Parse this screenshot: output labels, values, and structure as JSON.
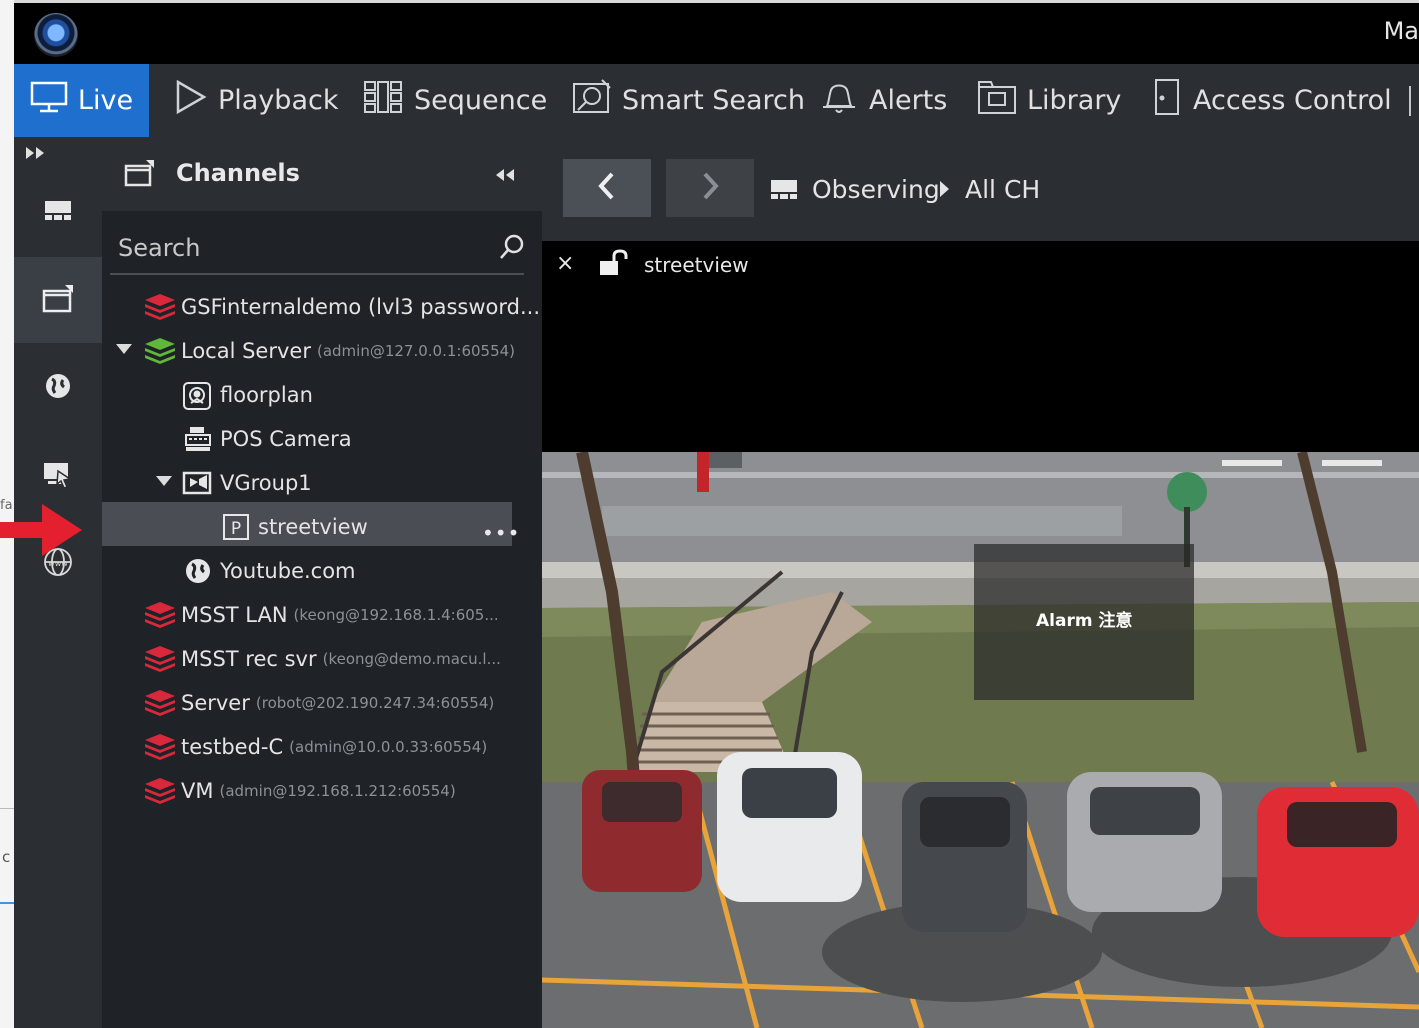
{
  "window": {
    "title_partial": "Ma"
  },
  "desktop": {
    "left_text_1": "fa",
    "left_text_2": "c"
  },
  "nav": {
    "items": [
      {
        "label": "Live",
        "icon": "monitor-icon",
        "active": true
      },
      {
        "label": "Playback",
        "icon": "play-icon"
      },
      {
        "label": "Sequence",
        "icon": "sequence-icon"
      },
      {
        "label": "Smart Search",
        "icon": "smart-search-icon"
      },
      {
        "label": "Alerts",
        "icon": "bell-icon"
      },
      {
        "label": "Library",
        "icon": "library-icon"
      },
      {
        "label": "Access Control",
        "icon": "door-icon"
      }
    ]
  },
  "rail": {
    "buttons": [
      "layout-icon",
      "channels-icon",
      "globe-icon",
      "remote-display-icon",
      "www-icon"
    ]
  },
  "panel": {
    "title": "Channels",
    "search_placeholder": "Search",
    "tree": [
      {
        "label": "GSFinternaldemo (lvl3 password...",
        "sub": "",
        "type": "server-red"
      },
      {
        "label": "Local Server",
        "sub": "(admin@127.0.0.1:60554)",
        "type": "server-green",
        "expanded": true
      },
      {
        "label": "floorplan",
        "sub": "",
        "type": "floorplan"
      },
      {
        "label": "POS Camera",
        "sub": "",
        "type": "pos"
      },
      {
        "label": "VGroup1",
        "sub": "",
        "type": "group",
        "expanded": true
      },
      {
        "label": "streetview",
        "sub": "",
        "type": "p-camera",
        "selected": true
      },
      {
        "label": "Youtube.com",
        "sub": "",
        "type": "globe"
      },
      {
        "label": "MSST LAN",
        "sub": "(keong@192.168.1.4:605...",
        "type": "server-red"
      },
      {
        "label": "MSST rec svr",
        "sub": "(keong@demo.macu.l...",
        "type": "server-red"
      },
      {
        "label": "Server",
        "sub": "(robot@202.190.247.34:60554)",
        "type": "server-red"
      },
      {
        "label": "testbed-C",
        "sub": "(admin@10.0.0.33:60554)",
        "type": "server-red"
      },
      {
        "label": "VM",
        "sub": "(admin@192.168.1.212:60554)",
        "type": "server-red"
      }
    ],
    "row_more": "•••"
  },
  "view": {
    "breadcrumb": {
      "first": "Observing",
      "second": "All CH"
    },
    "tile": {
      "close": "×",
      "name": "streetview"
    },
    "alarm_text": "Alarm 注意"
  },
  "colors": {
    "accent": "#1e6fce",
    "server_red": "#d9283c",
    "server_green": "#5fb83a",
    "annotation_arrow": "#e4202f"
  }
}
